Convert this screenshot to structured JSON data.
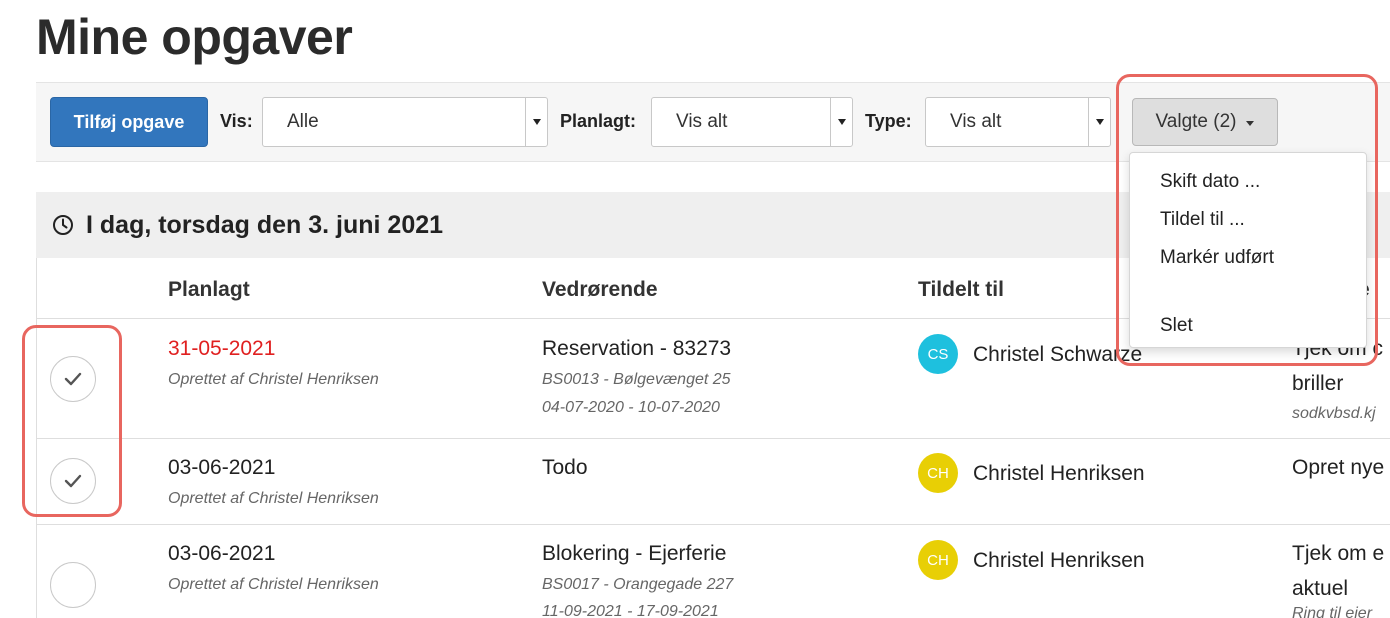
{
  "page": {
    "title": "Mine opgaver"
  },
  "toolbar": {
    "add_task_label": "Tilføj opgave",
    "vis_label": "Vis:",
    "vis_value": "Alle",
    "planlagt_label": "Planlagt:",
    "planlagt_value": "Vis alt",
    "type_label": "Type:",
    "type_value": "Vis alt",
    "selected_label": "Valgte (2)"
  },
  "dropdown": {
    "items": [
      "Skift dato ...",
      "Tildel til ...",
      "Markér udført",
      "Slet"
    ]
  },
  "section": {
    "date_header": "I dag, torsdag den 3. juni 2021"
  },
  "table": {
    "headers": [
      "Planlagt",
      "Vedrørende",
      "Tildelt til",
      "e"
    ],
    "rows": [
      {
        "checked": true,
        "planned": "31-05-2021",
        "overdue": true,
        "created_by": "Oprettet af Christel Henriksen",
        "regarding": "Reservation - 83273",
        "regarding_sub1": "BS0013 - Bølgevænget 25",
        "regarding_sub2": "04-07-2020 - 10-07-2020",
        "avatar_initials": "CS",
        "avatar_color": "#1ec0de",
        "assignee": "Christel Schwarze",
        "desc_line1": "Tjek om c",
        "desc_line2": "briller",
        "desc_sub": "sodkvbsd.kj"
      },
      {
        "checked": true,
        "planned": "03-06-2021",
        "overdue": false,
        "created_by": "Oprettet af Christel Henriksen",
        "regarding": "Todo",
        "avatar_initials": "CH",
        "avatar_color": "#e8cf05",
        "assignee": "Christel Henriksen",
        "desc_line1": "Opret nye"
      },
      {
        "checked": false,
        "planned": "03-06-2021",
        "overdue": false,
        "created_by": "Oprettet af Christel Henriksen",
        "regarding": "Blokering - Ejerferie",
        "regarding_sub1": "BS0017 - Orangegade 227",
        "regarding_sub2": "11-09-2021 - 17-09-2021",
        "avatar_initials": "CH",
        "avatar_color": "#e8cf05",
        "assignee": "Christel Henriksen",
        "desc_line1": "Tjek om e",
        "desc_line2": "aktuel",
        "desc_sub": "Ring til ejer"
      }
    ]
  },
  "colors": {
    "primary": "#3276bd",
    "highlight": "#e8665f",
    "overdue": "#e02020"
  }
}
